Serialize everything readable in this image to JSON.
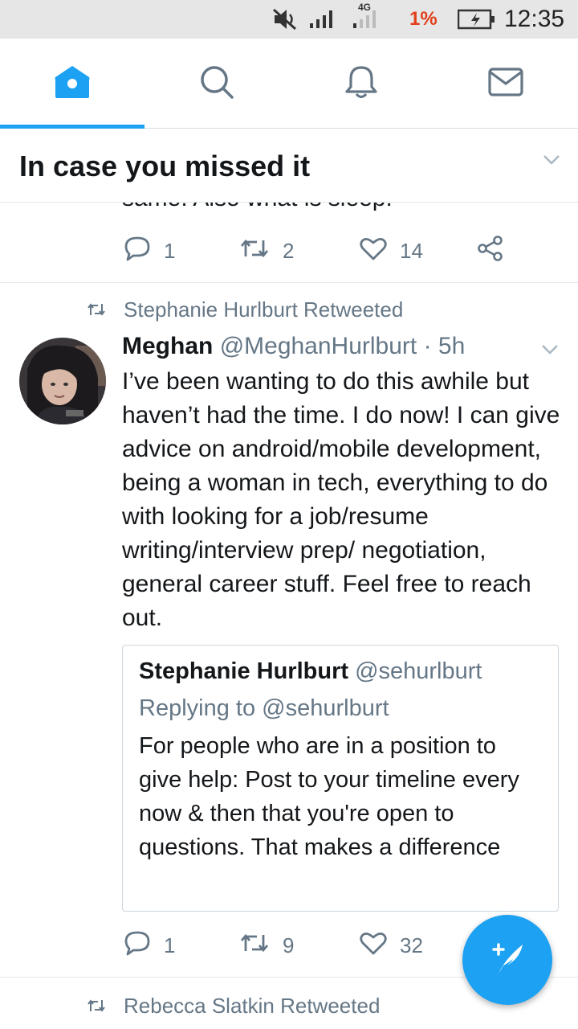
{
  "status_bar": {
    "network": "4G",
    "battery_percent": "1%",
    "time": "12:35",
    "icons": [
      "mute-icon",
      "signal-icon",
      "signal-4g-icon",
      "battery-charging-icon"
    ]
  },
  "tabs": [
    {
      "name": "home",
      "icon": "home-icon",
      "active": true
    },
    {
      "name": "search",
      "icon": "search-icon",
      "active": false
    },
    {
      "name": "notifications",
      "icon": "bell-icon",
      "active": false
    },
    {
      "name": "messages",
      "icon": "envelope-icon",
      "active": false
    }
  ],
  "section": {
    "title": "In case you missed it"
  },
  "previous_tweet": {
    "cut_text": "same. Also what is sleep.",
    "replies": "1",
    "retweets": "2",
    "likes": "14"
  },
  "tweet": {
    "retweeted_by": "Stephanie Hurlburt Retweeted",
    "author_name": "Meghan",
    "author_handle": "@MeghanHurlburt · 5h",
    "text": "I’ve been wanting to do this awhile but haven’t had the time. I do now! I can give advice on android/mobile development, being a woman in tech, everything to do with looking for a job/resume writing/interview prep/ negotiation, general career stuff. Feel free to reach out.",
    "quote": {
      "author_name": "Stephanie Hurlburt",
      "author_handle": "@sehurlburt",
      "replying_to": "Replying to @sehurlburt",
      "text": "For people who are in a position to give help: Post to your timeline every now & then that you're open to questions. That makes a difference"
    },
    "replies": "1",
    "retweets": "9",
    "likes": "32"
  },
  "next_tweet": {
    "retweeted_by": "Rebecca Slatkin Retweeted"
  },
  "colors": {
    "accent": "#1da1f2",
    "secondary_text": "#657786",
    "battery_low": "#e2401c"
  }
}
